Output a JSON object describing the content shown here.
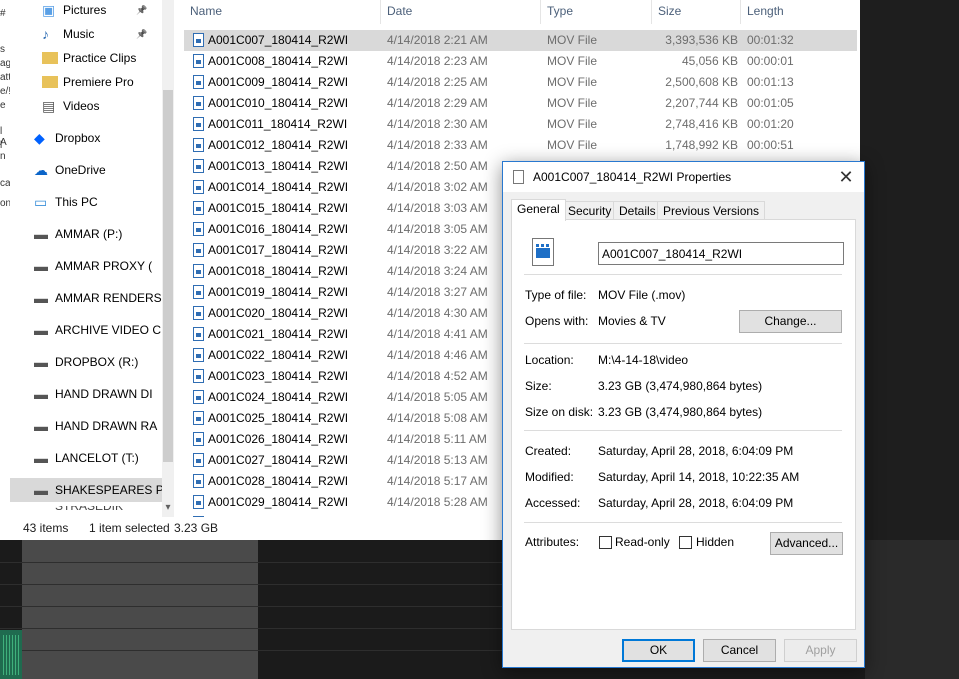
{
  "background": {
    "left_strip_fragments": [
      "#",
      "s",
      "ag",
      "att",
      "e/!",
      "e",
      "l A",
      "l n",
      "ca",
      "on"
    ]
  },
  "explorer": {
    "nav": {
      "items": [
        {
          "label": "Pictures",
          "icon": "pictures-folder-icon",
          "pinned": true
        },
        {
          "label": "Music",
          "icon": "music-folder-icon",
          "pinned": true
        },
        {
          "label": "Practice Clips",
          "icon": "folder-icon",
          "pinned": false
        },
        {
          "label": "Premiere Pro",
          "icon": "folder-icon",
          "pinned": false
        },
        {
          "label": "Videos",
          "icon": "videos-folder-icon",
          "pinned": false
        },
        {
          "label": "Dropbox",
          "icon": "dropbox-icon",
          "pinned": false
        },
        {
          "label": "OneDrive",
          "icon": "onedrive-cloud-icon",
          "pinned": false
        },
        {
          "label": "This PC",
          "icon": "computer-icon",
          "pinned": false
        },
        {
          "label": "AMMAR (P:)",
          "icon": "drive-icon",
          "pinned": false
        },
        {
          "label": "AMMAR PROXY (",
          "icon": "drive-icon",
          "pinned": false
        },
        {
          "label": "AMMAR RENDERS",
          "icon": "drive-icon",
          "pinned": false
        },
        {
          "label": "ARCHIVE VIDEO C",
          "icon": "drive-icon",
          "pinned": false
        },
        {
          "label": "DROPBOX (R:)",
          "icon": "drive-icon",
          "pinned": false
        },
        {
          "label": "HAND DRAWN DI",
          "icon": "drive-icon",
          "pinned": false
        },
        {
          "label": "HAND DRAWN RA",
          "icon": "drive-icon",
          "pinned": false
        },
        {
          "label": "LANCELOT (T:)",
          "icon": "drive-icon",
          "pinned": false
        },
        {
          "label": "SHAKESPEARES PA",
          "icon": "drive-icon",
          "pinned": false,
          "selected": true
        }
      ],
      "partial_bottom_label": "STRASEDIK"
    },
    "columns": [
      "Name",
      "Date",
      "Type",
      "Size",
      "Length"
    ],
    "files": [
      {
        "name": "A001C007_180414_R2WI",
        "date": "4/14/2018 2:21 AM",
        "type": "MOV File",
        "size": "3,393,536 KB",
        "length": "00:01:32",
        "selected": true
      },
      {
        "name": "A001C008_180414_R2WI",
        "date": "4/14/2018 2:23 AM",
        "type": "MOV File",
        "size": "45,056 KB",
        "length": "00:00:01"
      },
      {
        "name": "A001C009_180414_R2WI",
        "date": "4/14/2018 2:25 AM",
        "type": "MOV File",
        "size": "2,500,608 KB",
        "length": "00:01:13"
      },
      {
        "name": "A001C010_180414_R2WI",
        "date": "4/14/2018 2:29 AM",
        "type": "MOV File",
        "size": "2,207,744 KB",
        "length": "00:01:05"
      },
      {
        "name": "A001C011_180414_R2WI",
        "date": "4/14/2018 2:30 AM",
        "type": "MOV File",
        "size": "2,748,416 KB",
        "length": "00:01:20"
      },
      {
        "name": "A001C012_180414_R2WI",
        "date": "4/14/2018 2:33 AM",
        "type": "MOV File",
        "size": "1,748,992 KB",
        "length": "00:00:51"
      },
      {
        "name": "A001C013_180414_R2WI",
        "date": "4/14/2018 2:50 AM",
        "type": "",
        "size": "",
        "length": ""
      },
      {
        "name": "A001C014_180414_R2WI",
        "date": "4/14/2018 3:02 AM",
        "type": "",
        "size": "",
        "length": ""
      },
      {
        "name": "A001C015_180414_R2WI",
        "date": "4/14/2018 3:03 AM",
        "type": "",
        "size": "",
        "length": ""
      },
      {
        "name": "A001C016_180414_R2WI",
        "date": "4/14/2018 3:05 AM",
        "type": "",
        "size": "",
        "length": ""
      },
      {
        "name": "A001C017_180414_R2WI",
        "date": "4/14/2018 3:22 AM",
        "type": "",
        "size": "",
        "length": ""
      },
      {
        "name": "A001C018_180414_R2WI",
        "date": "4/14/2018 3:24 AM",
        "type": "",
        "size": "",
        "length": ""
      },
      {
        "name": "A001C019_180414_R2WI",
        "date": "4/14/2018 3:27 AM",
        "type": "",
        "size": "",
        "length": ""
      },
      {
        "name": "A001C020_180414_R2WI",
        "date": "4/14/2018 4:30 AM",
        "type": "",
        "size": "",
        "length": ""
      },
      {
        "name": "A001C021_180414_R2WI",
        "date": "4/14/2018 4:41 AM",
        "type": "",
        "size": "",
        "length": ""
      },
      {
        "name": "A001C022_180414_R2WI",
        "date": "4/14/2018 4:46 AM",
        "type": "",
        "size": "",
        "length": ""
      },
      {
        "name": "A001C023_180414_R2WI",
        "date": "4/14/2018 4:52 AM",
        "type": "",
        "size": "",
        "length": ""
      },
      {
        "name": "A001C024_180414_R2WI",
        "date": "4/14/2018 5:05 AM",
        "type": "",
        "size": "",
        "length": ""
      },
      {
        "name": "A001C025_180414_R2WI",
        "date": "4/14/2018 5:08 AM",
        "type": "",
        "size": "",
        "length": ""
      },
      {
        "name": "A001C026_180414_R2WI",
        "date": "4/14/2018 5:11 AM",
        "type": "",
        "size": "",
        "length": ""
      },
      {
        "name": "A001C027_180414_R2WI",
        "date": "4/14/2018 5:13 AM",
        "type": "",
        "size": "",
        "length": ""
      },
      {
        "name": "A001C028_180414_R2WI",
        "date": "4/14/2018 5:17 AM",
        "type": "",
        "size": "",
        "length": ""
      },
      {
        "name": "A001C029_180414_R2WI",
        "date": "4/14/2018 5:28 AM",
        "type": "",
        "size": "",
        "length": ""
      }
    ],
    "status": {
      "item_count": "43 items",
      "selection": "1 item selected",
      "selection_size": "3.23 GB"
    }
  },
  "dialog": {
    "title": "A001C007_180414_R2WI Properties",
    "tabs": [
      "General",
      "Security",
      "Details",
      "Previous Versions"
    ],
    "active_tab": "General",
    "file_name_value": "A001C007_180414_R2WI",
    "type_of_file_label": "Type of file:",
    "type_of_file_value": "MOV File (.mov)",
    "opens_with_label": "Opens with:",
    "opens_with_value": "Movies & TV",
    "change_button": "Change...",
    "location_label": "Location:",
    "location_value": "M:\\4-14-18\\video",
    "size_label": "Size:",
    "size_value": "3.23 GB (3,474,980,864 bytes)",
    "size_on_disk_label": "Size on disk:",
    "size_on_disk_value": "3.23 GB (3,474,980,864 bytes)",
    "created_label": "Created:",
    "created_value": "Saturday, April 28, 2018, 6:04:09 PM",
    "modified_label": "Modified:",
    "modified_value": "Saturday, April 14, 2018, 10:22:35 AM",
    "accessed_label": "Accessed:",
    "accessed_value": "Saturday, April 28, 2018, 6:04:09 PM",
    "attributes_label": "Attributes:",
    "readonly_label": "Read-only",
    "hidden_label": "Hidden",
    "advanced_button": "Advanced...",
    "ok_button": "OK",
    "cancel_button": "Cancel",
    "apply_button": "Apply",
    "close_glyph": "✕"
  },
  "colors": {
    "accent": "#0078d7",
    "selection": "#d9d9d9",
    "header_text": "#4c607a"
  }
}
